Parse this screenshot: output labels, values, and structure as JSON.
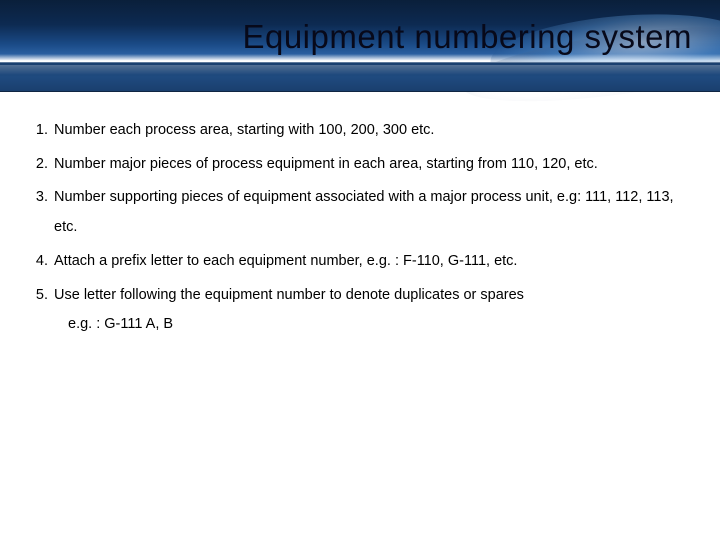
{
  "title": "Equipment numbering system",
  "items": [
    {
      "text": "Number each process area, starting with 100, 200, 300 etc."
    },
    {
      "text": "Number major pieces of process equipment in each area, starting from 110, 120, etc."
    },
    {
      "text": "Number supporting pieces of equipment associated with a major process unit, e.g: 111, 112, 113, etc."
    },
    {
      "text": "Attach a prefix letter to each equipment number, e.g. : F-110, G-111, etc."
    },
    {
      "text": "Use letter following the equipment number to denote duplicates or spares",
      "extra": "e.g. : G-111 A, B"
    }
  ]
}
